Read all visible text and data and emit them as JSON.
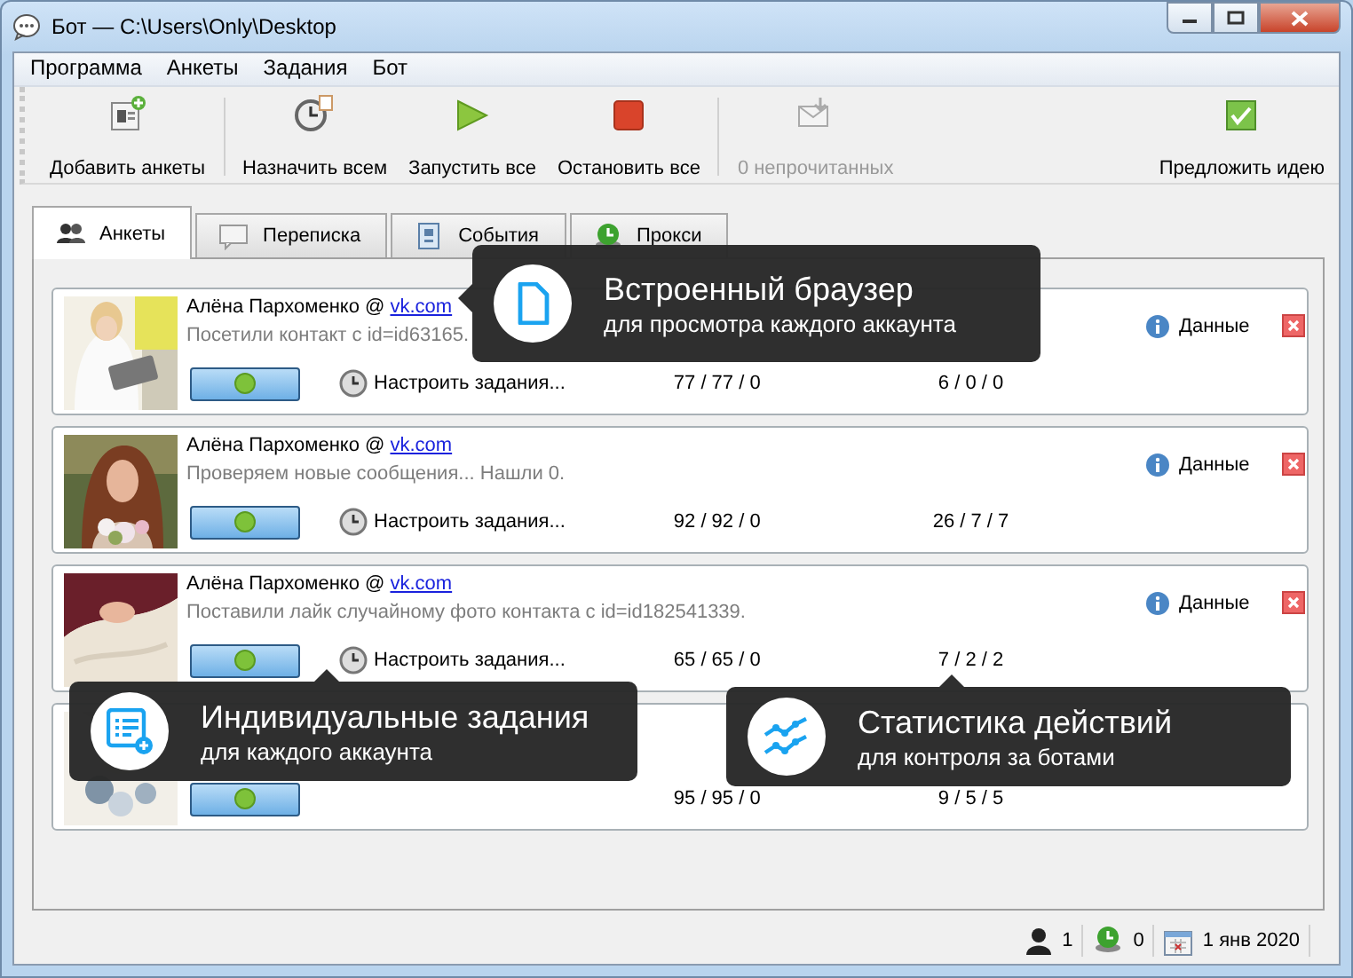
{
  "window": {
    "title": "Бот — C:\\Users\\Only\\Desktop"
  },
  "menu": [
    "Программа",
    "Анкеты",
    "Задания",
    "Бот"
  ],
  "toolbar": [
    {
      "kind": "add",
      "label": "Добавить анкеты",
      "disabled": false
    },
    {
      "kind": "assign",
      "label": "Назначить всем",
      "disabled": false
    },
    {
      "kind": "start",
      "label": "Запустить все",
      "disabled": false
    },
    {
      "kind": "stop",
      "label": "Остановить все",
      "disabled": false
    },
    {
      "kind": "mail",
      "label": "0 непрочитанных",
      "disabled": true
    },
    {
      "kind": "idea",
      "label": "Предложить идею",
      "disabled": false
    }
  ],
  "tabs": [
    {
      "kind": "people",
      "label": "Анкеты",
      "selected": true
    },
    {
      "kind": "chat",
      "label": "Переписка",
      "selected": false
    },
    {
      "kind": "events",
      "label": "События",
      "selected": false
    },
    {
      "kind": "proxy",
      "label": "Прокси",
      "selected": false
    }
  ],
  "accounts": [
    {
      "name": "Алёна Пархоменко @ ",
      "site": "vk.com",
      "status": "Посетили контакт с id=id63165.",
      "task_label": "Настроить задания...",
      "stats_a": "77 / 77 / 0",
      "stats_b": "6 / 0 / 0",
      "data_label": "Данные"
    },
    {
      "name": "Алёна Пархоменко @ ",
      "site": "vk.com",
      "status": "Проверяем новые сообщения... Нашли 0.",
      "task_label": "Настроить задания...",
      "stats_a": "92 / 92 / 0",
      "stats_b": "26 / 7 / 7",
      "data_label": "Данные"
    },
    {
      "name": "Алёна Пархоменко @ ",
      "site": "vk.com",
      "status": "Поставили лайк случайному фото контакта с id=id182541339.",
      "task_label": "Настроить задания...",
      "stats_a": "65 / 65 / 0",
      "stats_b": "7 / 2 / 2",
      "data_label": "Данные"
    },
    {
      "stats_a": "95 / 95 / 0",
      "stats_b": "9 / 5 / 5"
    }
  ],
  "callouts": [
    {
      "kind": "browser",
      "title": "Встроенный браузер",
      "subtitle": "для просмотра каждого аккаунта"
    },
    {
      "kind": "tasks",
      "title": "Индивидуальные задания",
      "subtitle": "для каждого аккаунта"
    },
    {
      "kind": "stats",
      "title": "Статистика действий",
      "subtitle": "для контроля за ботами"
    }
  ],
  "status_bar": {
    "users": "1",
    "proxies": "0",
    "date": "1 янв 2020"
  }
}
